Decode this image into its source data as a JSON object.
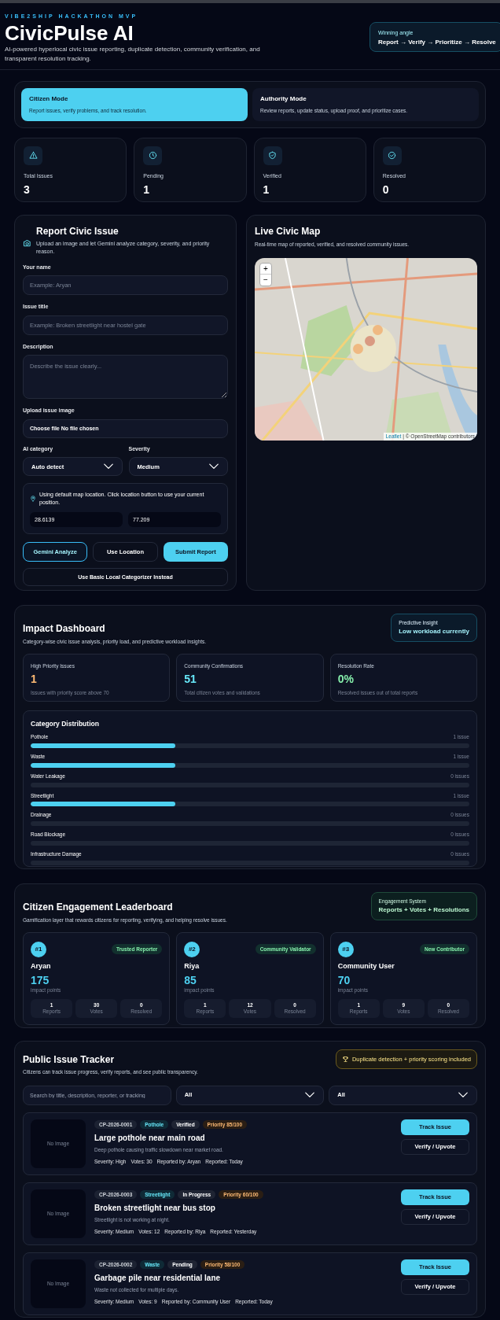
{
  "header": {
    "overline": "VIBE2SHIP HACKATHON MVP",
    "title": "CivicPulse AI",
    "description": "AI-powered hyperlocal civic issue reporting, duplicate detection, community verification, and transparent resolution tracking.",
    "angle": {
      "label": "Winning angle",
      "value": "Report → Verify → Prioritize → Resolve"
    }
  },
  "modes": [
    {
      "title": "Citizen Mode",
      "description": "Report issues, verify problems, and track resolution.",
      "selected": true
    },
    {
      "title": "Authority Mode",
      "description": "Review reports, update status, upload proof, and prioritize cases.",
      "selected": false
    }
  ],
  "stats": [
    {
      "label": "Total Issues",
      "value": "3"
    },
    {
      "label": "Pending",
      "value": "1"
    },
    {
      "label": "Verified",
      "value": "1"
    },
    {
      "label": "Resolved",
      "value": "0"
    }
  ],
  "report": {
    "title": "Report Civic Issue",
    "description": "Upload an image and let Gemini analyze category, severity, and priority reason.",
    "name": {
      "label": "Your name",
      "placeholder": "Example: Aryan"
    },
    "issue_title": {
      "label": "Issue title",
      "placeholder": "Example: Broken streetlight near hostel gate"
    },
    "description_field": {
      "label": "Description",
      "placeholder": "Describe the issue clearly..."
    },
    "upload": {
      "label": "Upload issue image",
      "value": "Choose file No file chosen"
    },
    "category": {
      "label": "AI category",
      "value": "Auto detect"
    },
    "severity": {
      "label": "Severity",
      "value": "Medium"
    },
    "location": {
      "note": "Using default map location. Click location button to use your current position.",
      "lat": "28.6139",
      "lng": "77.209"
    },
    "buttons": [
      {
        "label": "Gemini Analyze",
        "kind": "outline"
      },
      {
        "label": "Use Location",
        "kind": "plain"
      },
      {
        "label": "Submit Report",
        "kind": "primary"
      }
    ],
    "fallback_button": "Use Basic Local Categorizer Instead"
  },
  "map": {
    "title": "Live Civic Map",
    "description": "Real-time map of reported, verified, and resolved community issues.",
    "zoom_in": "+",
    "zoom_out": "−",
    "attribution_link": "Leaflet",
    "attribution": "| © OpenStreetMap contributors"
  },
  "impact": {
    "title": "Impact Dashboard",
    "description": "Category-wise civic issue analysis, priority load, and predictive workload insights.",
    "insight": {
      "label": "Predictive Insight",
      "value": "Low workload currently"
    },
    "metrics": [
      {
        "label": "High Priority Issues",
        "value": "1",
        "note": "Issues with priority score above 70",
        "color": "#fdba74"
      },
      {
        "label": "Community Confirmations",
        "value": "51",
        "note": "Total citizen votes and validations",
        "color": "#67e8f9"
      },
      {
        "label": "Resolution Rate",
        "value": "0%",
        "note": "Resolved issues out of total reports",
        "color": "#86efac"
      }
    ],
    "distribution": {
      "title": "Category Distribution",
      "items": [
        {
          "name": "Pothole",
          "count": "1 issue",
          "level": 0.33
        },
        {
          "name": "Waste",
          "count": "1 issue",
          "level": 0.33
        },
        {
          "name": "Water Leakage",
          "count": "0 issues"
        },
        {
          "name": "Streetlight",
          "count": "1 issue",
          "level": 0.33
        },
        {
          "name": "Drainage",
          "count": "0 issues"
        },
        {
          "name": "Road Blockage",
          "count": "0 issues"
        },
        {
          "name": "Infrastructure Damage",
          "count": "0 issues"
        }
      ]
    }
  },
  "leaderboard": {
    "title": "Citizen Engagement Leaderboard",
    "description": "Gamification layer that rewards citizens for reporting, verifying, and helping resolve issues.",
    "system": {
      "label": "Engagement System",
      "value": "Reports + Votes + Resolutions"
    },
    "users": [
      {
        "rank": "#1",
        "badge": "Trusted Reporter",
        "name": "Aryan",
        "points": "175",
        "points_label": "impact points",
        "stats": [
          {
            "value": "1",
            "label": "Reports"
          },
          {
            "value": "30",
            "label": "Votes"
          },
          {
            "value": "0",
            "label": "Resolved"
          }
        ]
      },
      {
        "rank": "#2",
        "badge": "Community Validator",
        "name": "Riya",
        "points": "85",
        "points_label": "impact points",
        "stats": [
          {
            "value": "1",
            "label": "Reports"
          },
          {
            "value": "12",
            "label": "Votes"
          },
          {
            "value": "0",
            "label": "Resolved"
          }
        ]
      },
      {
        "rank": "#3",
        "badge": "New Contributor",
        "name": "Community User",
        "points": "70",
        "points_label": "impact points",
        "stats": [
          {
            "value": "1",
            "label": "Reports"
          },
          {
            "value": "9",
            "label": "Votes"
          },
          {
            "value": "0",
            "label": "Resolved"
          }
        ]
      }
    ]
  },
  "tracker": {
    "title": "Public Issue Tracker",
    "description": "Citizens can track issue progress, verify reports, and see public transparency.",
    "note": "Duplicate detection + priority scoring included",
    "search_placeholder": "Search by title, description, reporter, or tracking",
    "filters": [
      "All",
      "All"
    ],
    "issues": [
      {
        "image_text": "No Image",
        "tags": [
          {
            "text": "CP-2026-0001",
            "kind": "id"
          },
          {
            "text": "Pothole",
            "kind": "category"
          },
          {
            "text": "Verified",
            "kind": "status"
          },
          {
            "text": "Priority 85/100",
            "kind": "priority"
          }
        ],
        "title": "Large pothole near main road",
        "description": "Deep pothole causing traffic slowdown near market road.",
        "meta": [
          "Severity: High",
          "Votes: 30",
          "Reported by: Aryan",
          "Reported: Today"
        ],
        "buttons": [
          "Track Issue",
          "Verify / Upvote"
        ]
      },
      {
        "image_text": "No Image",
        "tags": [
          {
            "text": "CP-2026-0003",
            "kind": "id"
          },
          {
            "text": "Streetlight",
            "kind": "category"
          },
          {
            "text": "In Progress",
            "kind": "status"
          },
          {
            "text": "Priority 60/100",
            "kind": "priority"
          }
        ],
        "title": "Broken streetlight near bus stop",
        "description": "Streetlight is not working at night.",
        "meta": [
          "Severity: Medium",
          "Votes: 12",
          "Reported by: Riya",
          "Reported: Yesterday"
        ],
        "buttons": [
          "Track Issue",
          "Verify / Upvote"
        ]
      },
      {
        "image_text": "No Image",
        "tags": [
          {
            "text": "CP-2026-0002",
            "kind": "id"
          },
          {
            "text": "Waste",
            "kind": "category"
          },
          {
            "text": "Pending",
            "kind": "status"
          },
          {
            "text": "Priority 58/100",
            "kind": "priority"
          }
        ],
        "title": "Garbage pile near residential lane",
        "description": "Waste not collected for multiple days.",
        "meta": [
          "Severity: Medium",
          "Votes: 9",
          "Reported by: Community User",
          "Reported: Today"
        ],
        "buttons": [
          "Track Issue",
          "Verify / Upvote"
        ]
      }
    ]
  }
}
